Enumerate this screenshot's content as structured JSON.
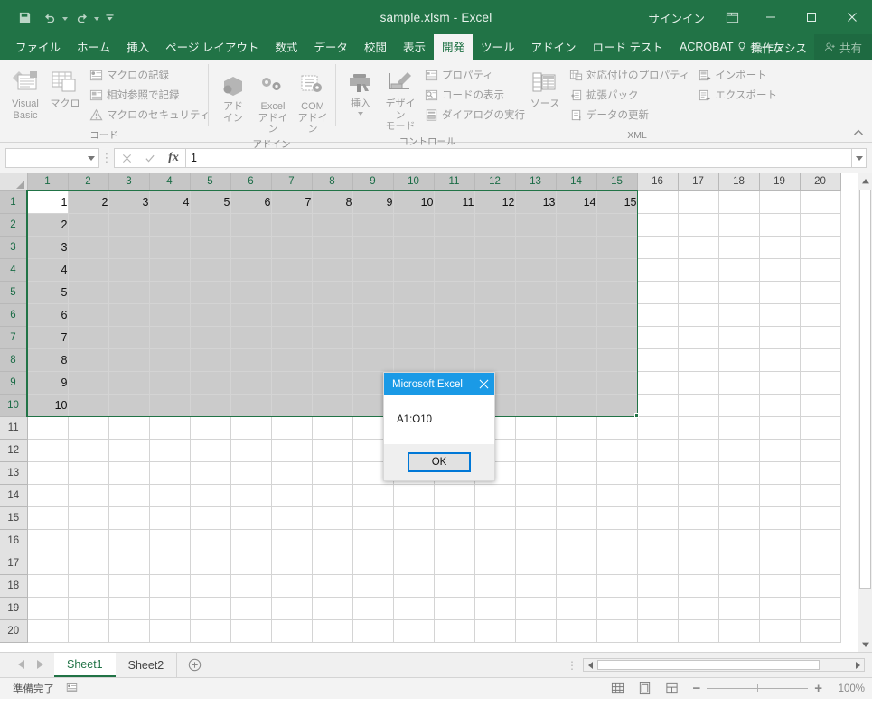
{
  "window": {
    "title": "sample.xlsm  -  Excel",
    "signin_label": "サインイン",
    "ribbon_display_options": "ribbon-display-options-icon",
    "minimize": "minimize-icon",
    "maximize": "maximize-icon",
    "close": "close-icon"
  },
  "quick_access": [
    {
      "name": "save",
      "icon": "save-icon"
    },
    {
      "name": "undo",
      "icon": "undo-icon"
    },
    {
      "name": "redo",
      "icon": "redo-icon"
    },
    {
      "name": "customize",
      "icon": "chevron-down-icon"
    }
  ],
  "tabs": [
    {
      "label": "ファイル",
      "active": false
    },
    {
      "label": "ホーム",
      "active": false
    },
    {
      "label": "挿入",
      "active": false
    },
    {
      "label": "ページ レイアウト",
      "active": false
    },
    {
      "label": "数式",
      "active": false
    },
    {
      "label": "データ",
      "active": false
    },
    {
      "label": "校閲",
      "active": false
    },
    {
      "label": "表示",
      "active": false
    },
    {
      "label": "開発",
      "active": true
    },
    {
      "label": "ツール",
      "active": false
    },
    {
      "label": "アドイン",
      "active": false
    },
    {
      "label": "ロード テスト",
      "active": false
    },
    {
      "label": "ACROBAT",
      "active": false
    },
    {
      "label": "チーム",
      "active": false
    }
  ],
  "tell_me": "操作アシス",
  "share_label": "共有",
  "ribbon": {
    "collapse_label": "collapse-ribbon-icon",
    "groups": [
      {
        "label": "コード",
        "big": [
          {
            "label": "Visual Basic",
            "icon": "visual-basic-icon"
          },
          {
            "label": "マクロ",
            "icon": "macros-icon"
          }
        ],
        "small": [
          {
            "label": "マクロの記録",
            "icon": "record-macro-icon"
          },
          {
            "label": "相対参照で記録",
            "icon": "relative-reference-icon"
          },
          {
            "label": "マクロのセキュリティ",
            "icon": "macro-security-icon"
          }
        ]
      },
      {
        "label": "アドイン",
        "big": [
          {
            "label": "アド\nイン",
            "icon": "add-ins-icon"
          },
          {
            "label": "Excel\nアドイン",
            "icon": "excel-add-ins-icon"
          },
          {
            "label": "COM\nアドイン",
            "icon": "com-add-ins-icon"
          }
        ],
        "small": []
      },
      {
        "label": "コントロール",
        "big": [
          {
            "label": "挿入",
            "icon": "insert-control-icon",
            "dropdown": true
          },
          {
            "label": "デザイン\nモード",
            "icon": "design-mode-icon"
          }
        ],
        "small": [
          {
            "label": "プロパティ",
            "icon": "properties-icon"
          },
          {
            "label": "コードの表示",
            "icon": "view-code-icon"
          },
          {
            "label": "ダイアログの実行",
            "icon": "run-dialog-icon"
          }
        ]
      },
      {
        "label": "XML",
        "big": [
          {
            "label": "ソース",
            "icon": "xml-source-icon"
          }
        ],
        "small": [
          {
            "label": "対応付けのプロパティ",
            "icon": "map-properties-icon"
          },
          {
            "label": "拡張パック",
            "icon": "expansion-packs-icon"
          },
          {
            "label": "データの更新",
            "icon": "refresh-data-icon"
          }
        ],
        "small2": [
          {
            "label": "インポート",
            "icon": "import-icon"
          },
          {
            "label": "エクスポート",
            "icon": "export-icon"
          }
        ]
      }
    ]
  },
  "formula_bar": {
    "name_box_value": "",
    "name_box_placeholder": "",
    "cancel_icon": "cancel-icon",
    "enter_icon": "enter-icon",
    "function_icon": "insert-function-icon",
    "formula_value": "1",
    "expand_icon": "expand-formula-bar-icon"
  },
  "grid": {
    "reference_style": "R1C1",
    "column_headers": [
      "1",
      "2",
      "3",
      "4",
      "5",
      "6",
      "7",
      "8",
      "9",
      "10",
      "11",
      "12",
      "13",
      "14",
      "15",
      "16",
      "17",
      "18",
      "19",
      "20"
    ],
    "row_headers": [
      "1",
      "2",
      "3",
      "4",
      "5",
      "6",
      "7",
      "8",
      "9",
      "10",
      "11",
      "12",
      "13",
      "14",
      "15",
      "16",
      "17",
      "18",
      "19",
      "20"
    ],
    "selection_range": "R1C1:R10C15",
    "selected_columns": 15,
    "selected_rows": 10,
    "active_cell": "R1C1",
    "row1_values": [
      "1",
      "2",
      "3",
      "4",
      "5",
      "6",
      "7",
      "8",
      "9",
      "10",
      "11",
      "12",
      "13",
      "14",
      "15"
    ],
    "col1_values": [
      "1",
      "2",
      "3",
      "4",
      "5",
      "6",
      "7",
      "8",
      "9",
      "10"
    ]
  },
  "sheet_tabs": {
    "prev_icon": "prev-sheet-icon",
    "next_icon": "next-sheet-icon",
    "tabs": [
      {
        "label": "Sheet1",
        "active": true
      },
      {
        "label": "Sheet2",
        "active": false
      }
    ],
    "add_label": "add-sheet-icon"
  },
  "status_bar": {
    "status_text": "準備完了",
    "macro_record_icon": "record-macro-status-icon",
    "views": [
      {
        "name": "normal-view",
        "icon": "normal-view-icon"
      },
      {
        "name": "page-layout-view",
        "icon": "page-layout-view-icon"
      },
      {
        "name": "page-break-preview",
        "icon": "page-break-preview-icon"
      }
    ],
    "zoom_out": "−",
    "zoom_in": "+",
    "zoom_level": "100%"
  },
  "dialog": {
    "title": "Microsoft Excel",
    "close_icon": "dialog-close-icon",
    "message": "A1:O10",
    "ok_label": "OK"
  }
}
